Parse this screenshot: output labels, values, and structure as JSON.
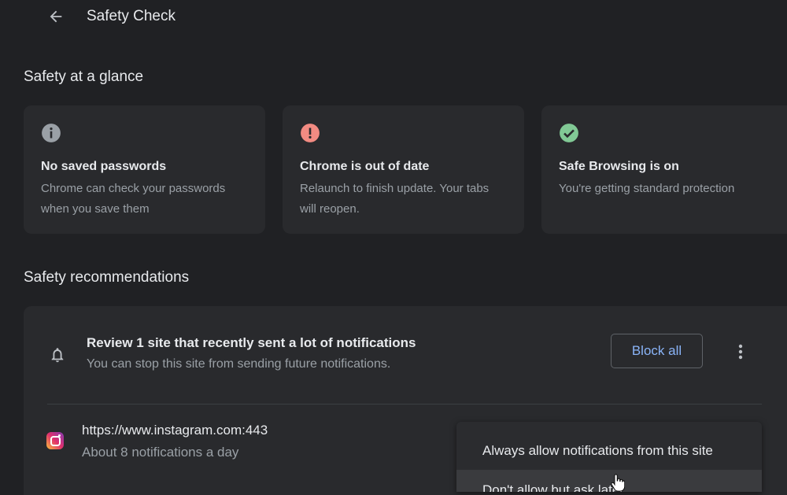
{
  "header": {
    "title": "Safety Check",
    "back_icon": "arrow-left-icon"
  },
  "glance": {
    "title": "Safety at a glance",
    "cards": [
      {
        "icon": "info-icon",
        "icon_color": "#9aa0a6",
        "title": "No saved passwords",
        "desc": "Chrome can check your passwords when you save them"
      },
      {
        "icon": "error-icon",
        "icon_color": "#f28b82",
        "title": "Chrome is out of date",
        "desc": "Relaunch to finish update. Your tabs will reopen."
      },
      {
        "icon": "check-circle-icon",
        "icon_color": "#81c995",
        "title": "Safe Browsing is on",
        "desc": "You're getting standard protection"
      }
    ]
  },
  "recommendations": {
    "title": "Safety recommendations",
    "heading": "Review 1 site that recently sent a lot of notifications",
    "subtext": "You can stop this site from sending future notifications.",
    "block_all_label": "Block all",
    "site": {
      "url": "https://www.instagram.com:443",
      "count": "About 8 notifications a day"
    }
  },
  "context_menu": {
    "items": [
      "Always allow notifications from this site",
      "Don't allow but ask later"
    ]
  },
  "colors": {
    "background": "#202124",
    "card": "#292a2d",
    "accent": "#8ab4f8",
    "muted_text": "#9aa0a6"
  }
}
